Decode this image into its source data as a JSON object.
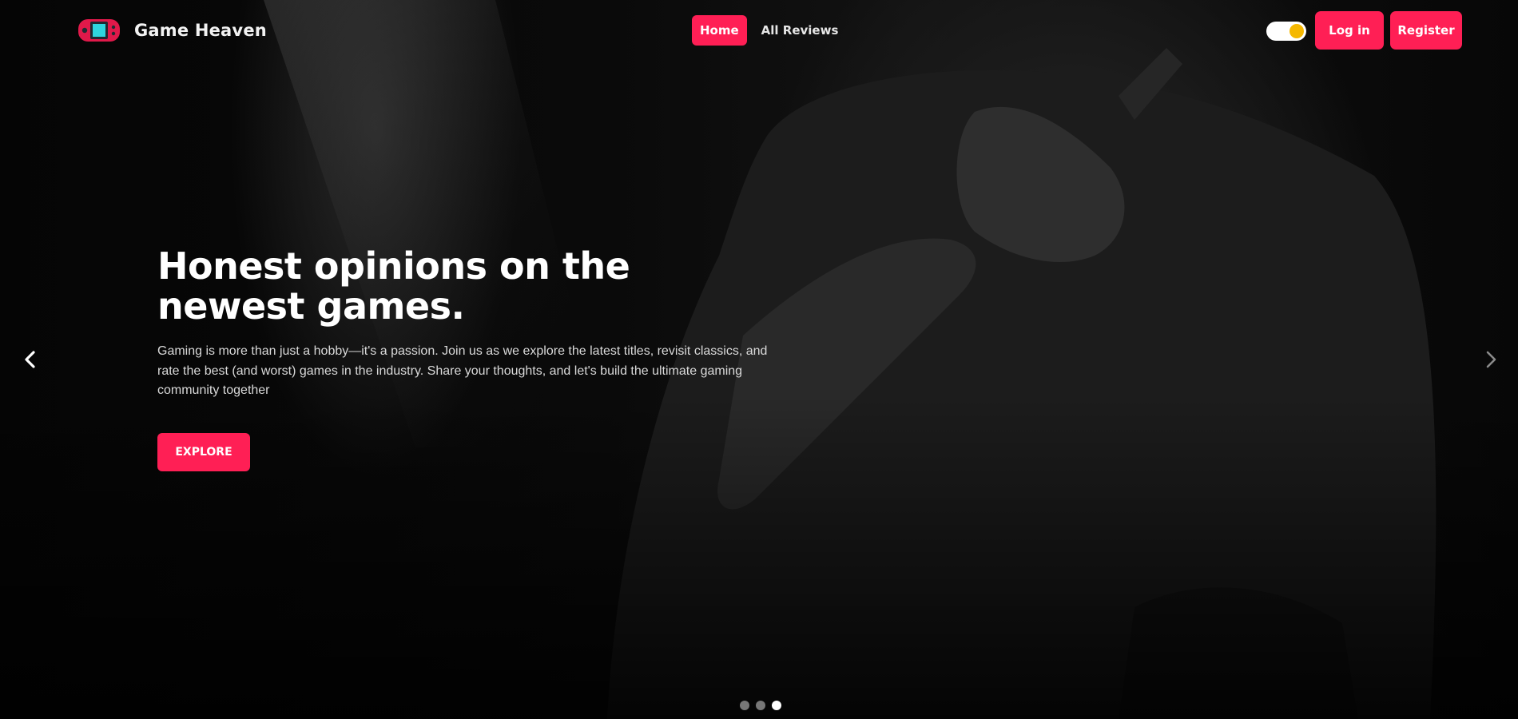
{
  "brand": {
    "name": "Game Heaven",
    "logo_icon": "gamepad-icon"
  },
  "nav": {
    "links": [
      {
        "label": "Home",
        "active": true
      },
      {
        "label": "All Reviews",
        "active": false
      }
    ]
  },
  "header": {
    "theme_toggle": {
      "state": "on",
      "knob_color": "#f5b800"
    },
    "login_label": "Log in",
    "register_label": "Register"
  },
  "hero": {
    "title": "Honest opinions on the newest games.",
    "text": "Gaming is more than just a hobby—it's a passion. Join us as we explore the latest titles, revisit classics, and rate the best (and worst) games in the industry. Share your thoughts, and let's build the ultimate gaming community together",
    "cta_label": "EXPLORE"
  },
  "carousel": {
    "prev_icon": "chevron-left-icon",
    "next_icon": "chevron-right-icon",
    "slide_count": 3,
    "active_slide": 3
  },
  "colors": {
    "accent": "#ff1f55",
    "background": "#000000",
    "text": "#ffffff"
  }
}
